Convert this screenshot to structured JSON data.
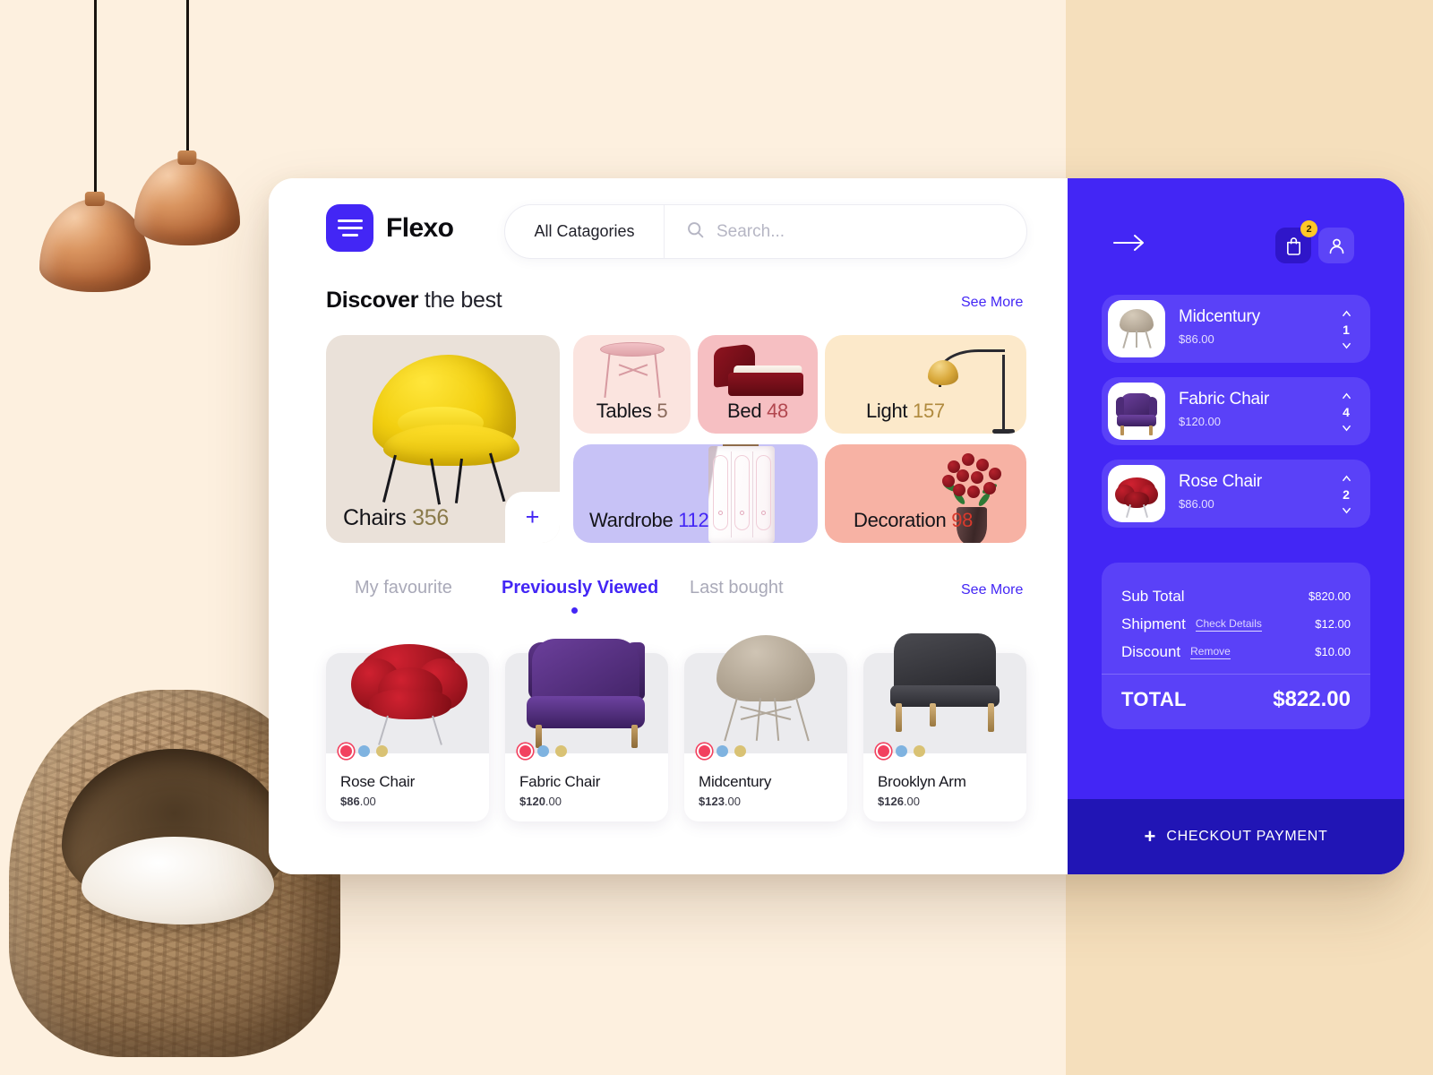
{
  "header": {
    "logo_text": "Flexo",
    "logo_icon": "hamburger-logo-icon",
    "category_select": "All Catagories",
    "search_placeholder": "Search...",
    "search_value": "",
    "search_icon": "search-icon"
  },
  "discover": {
    "title_bold": "Discover",
    "title_rest": " the best",
    "see_more": "See More",
    "add_icon": "plus-icon"
  },
  "categories": [
    {
      "name": "Chairs",
      "count": "356",
      "bg": "#EAE1D9",
      "num_color": "#8a7a4a"
    },
    {
      "name": "Tables",
      "count": "5",
      "bg": "#FBE4DF",
      "num_color": "#8a6a5c"
    },
    {
      "name": "Bed",
      "count": "48",
      "bg": "#F6BFC2",
      "num_color": "#b2474f"
    },
    {
      "name": "Light",
      "count": "157",
      "bg": "#FCE9CA",
      "num_color": "#b08a3e"
    },
    {
      "name": "Wardrobe",
      "count": "112",
      "bg": "#C7C2F6",
      "num_color": "#4326F5"
    },
    {
      "name": "Decoration",
      "count": "98",
      "bg": "#F7B2A4",
      "num_color": "#d9392c"
    }
  ],
  "tabs": {
    "items": [
      {
        "label": "My favourite",
        "active": false
      },
      {
        "label": "Previously Viewed",
        "active": true
      },
      {
        "label": "Last bought",
        "active": false
      }
    ],
    "see_more": "See More"
  },
  "products": [
    {
      "name": "Rose Chair",
      "price_main": "$86",
      "price_cents": ".00",
      "swatches": [
        "#F2415F",
        "#7FB3E0",
        "#D9C274"
      ]
    },
    {
      "name": "Fabric Chair",
      "price_main": "$120",
      "price_cents": ".00",
      "swatches": [
        "#F2415F",
        "#7FB3E0",
        "#D9C274"
      ]
    },
    {
      "name": "Midcentury",
      "price_main": "$123",
      "price_cents": ".00",
      "swatches": [
        "#F2415F",
        "#7FB3E0",
        "#D9C274"
      ]
    },
    {
      "name": "Brooklyn Arm",
      "price_main": "$126",
      "price_cents": ".00",
      "swatches": [
        "#F2415F",
        "#7FB3E0",
        "#D9C274"
      ]
    }
  ],
  "cart": {
    "back_icon": "arrow-right-icon",
    "bag_icon": "shopping-bag-icon",
    "bag_badge": "2",
    "user_icon": "user-avatar-icon",
    "items": [
      {
        "name": "Midcentury",
        "price": "$86.00",
        "qty": "1"
      },
      {
        "name": "Fabric Chair",
        "price": "$120.00",
        "qty": "4"
      },
      {
        "name": "Rose Chair",
        "price": "$86.00",
        "qty": "2"
      }
    ],
    "summary": [
      {
        "label": "Sub Total",
        "action": "",
        "value": "$820.00"
      },
      {
        "label": "Shipment",
        "action": "Check Details",
        "value": "$12.00"
      },
      {
        "label": "Discount",
        "action": "Remove",
        "value": "$10.00"
      }
    ],
    "total_label": "TOTAL",
    "total_value": "$822.00",
    "checkout_label": "CHECKOUT PAYMENT",
    "checkout_icon": "plus-icon"
  },
  "theme": {
    "accent": "#4326F5",
    "accent_dark": "#2115B5",
    "badge": "#FFC727",
    "bg_left": "#FDF0DF",
    "bg_right": "#F5DFBC"
  }
}
